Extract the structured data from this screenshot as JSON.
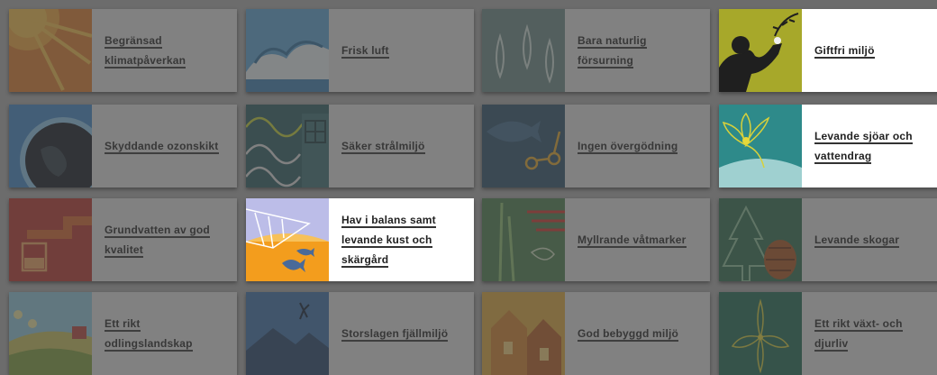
{
  "cards": [
    {
      "label": "Begränsad klimatpåverkan",
      "active": false
    },
    {
      "label": "Frisk luft",
      "active": false
    },
    {
      "label": "Bara naturlig försurning",
      "active": false
    },
    {
      "label": "Giftfri miljö",
      "active": true
    },
    {
      "label": "Skyddande ozonskikt",
      "active": false
    },
    {
      "label": "Säker strålmiljö",
      "active": false
    },
    {
      "label": "Ingen övergödning",
      "active": false
    },
    {
      "label": "Levande sjöar och vattendrag",
      "active": true
    },
    {
      "label": "Grundvatten av god kvalitet",
      "active": false
    },
    {
      "label": "Hav i balans samt levande kust och skärgård",
      "active": true
    },
    {
      "label": "Myllrande våtmarker",
      "active": false
    },
    {
      "label": "Levande skogar",
      "active": false
    },
    {
      "label": "Ett rikt odlingslandskap",
      "active": false
    },
    {
      "label": "Storslagen fjällmiljö",
      "active": false
    },
    {
      "label": "God bebyggd miljö",
      "active": false
    },
    {
      "label": "Ett rikt växt- och djurliv",
      "active": false
    }
  ]
}
